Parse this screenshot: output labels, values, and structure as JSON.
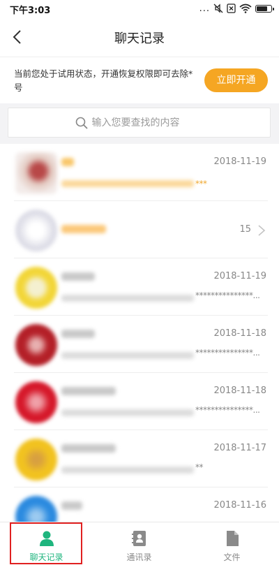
{
  "status_bar": {
    "time": "下午3:03",
    "dots": "...",
    "battery_level": 0.75
  },
  "header": {
    "title": "聊天记录"
  },
  "trial_banner": {
    "text": "当前您处于试用状态，开通恢复权限即可去除*号",
    "button_label": "立即开通"
  },
  "search": {
    "placeholder": "输入您要查找的内容"
  },
  "chats": [
    {
      "date": "2018-11-19",
      "preview_suffix": "***",
      "count": ""
    },
    {
      "date": "",
      "preview_suffix": "",
      "count": "15"
    },
    {
      "date": "2018-11-19",
      "preview_suffix": "***************...",
      "count": ""
    },
    {
      "date": "2018-11-18",
      "preview_suffix": "***************...",
      "count": ""
    },
    {
      "date": "2018-11-18",
      "preview_suffix": "***************...",
      "count": ""
    },
    {
      "date": "2018-11-17",
      "preview_suffix": "**",
      "count": ""
    },
    {
      "date": "2018-11-16",
      "preview_suffix": "",
      "count": ""
    }
  ],
  "tabs": [
    {
      "label": "聊天记录",
      "icon": "person-icon",
      "active": true
    },
    {
      "label": "通讯录",
      "icon": "contacts-book-icon",
      "active": false
    },
    {
      "label": "文件",
      "icon": "file-icon",
      "active": false
    }
  ],
  "colors": {
    "accent_orange": "#f5a623",
    "active_green": "#1fb57e",
    "highlight_red": "#e02020"
  }
}
